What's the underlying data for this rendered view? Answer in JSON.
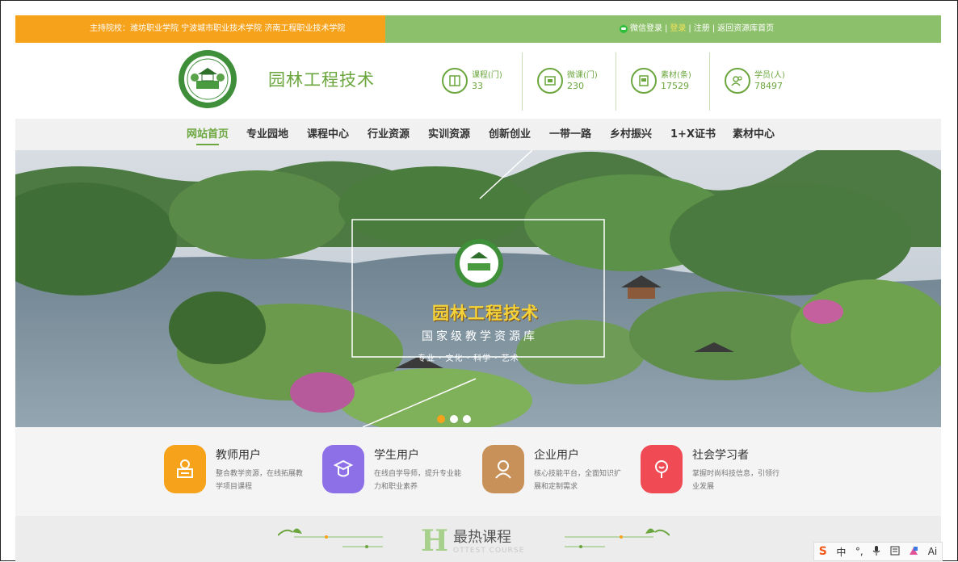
{
  "topbar": {
    "hosts": "主持院校：潍坊职业学院  宁波城市职业技术学院 济南工程职业技术学院",
    "wechat_login": "微信登录",
    "login": "登录",
    "register": "注册",
    "back_home": "返回资源库首页",
    "sep": "|"
  },
  "header": {
    "title": "园林工程技术",
    "stats": [
      {
        "label": "课程(门)",
        "value": "33",
        "icon": "book-icon"
      },
      {
        "label": "微课(门)",
        "value": "230",
        "icon": "video-icon"
      },
      {
        "label": "素材(条)",
        "value": "17529",
        "icon": "material-icon"
      },
      {
        "label": "学员(人)",
        "value": "78497",
        "icon": "users-icon"
      }
    ]
  },
  "nav": {
    "items": [
      "网站首页",
      "专业园地",
      "课程中心",
      "行业资源",
      "实训资源",
      "创新创业",
      "一带一路",
      "乡村振兴",
      "1+X证书",
      "素材中心"
    ]
  },
  "banner": {
    "title": "园林工程技术",
    "subtitle": "国家级教学资源库",
    "tagline": "专业 · 文化 · 科学 · 艺术",
    "slides": 3,
    "active_slide": 1
  },
  "users": [
    {
      "title": "教师用户",
      "desc": "整合教学资源，在线拓展教学项目课程",
      "color": "#f7a21b"
    },
    {
      "title": "学生用户",
      "desc": "在线自学导师，提升专业能力和职业素养",
      "color": "#8d6fe8"
    },
    {
      "title": "企业用户",
      "desc": "核心技能平台，全面知识扩展和定制需求",
      "color": "#c9915a"
    },
    {
      "title": "社会学习者",
      "desc": "掌握时尚科技信息，引领行业发展",
      "color": "#f04b55"
    }
  ],
  "hot": {
    "title": "最热课程",
    "subtitle": "OTTEST COURSE",
    "letter": "H"
  },
  "ime": {
    "logo": "S",
    "lang": "中",
    "punct": "°,",
    "mic": "mic-icon",
    "keyboard": "keyboard-icon",
    "skin": "skin-icon",
    "ai": "Ai"
  }
}
